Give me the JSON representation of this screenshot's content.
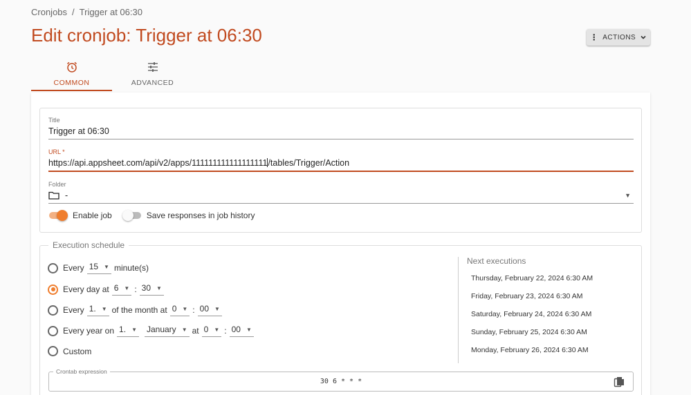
{
  "breadcrumb": {
    "root": "Cronjobs",
    "separator": "/",
    "current": "Trigger at 06:30"
  },
  "page_title": "Edit cronjob: Trigger at 06:30",
  "actions_label": "ACTIONS",
  "tabs": [
    {
      "label": "COMMON",
      "icon": "alarm-clock-icon",
      "active": true
    },
    {
      "label": "ADVANCED",
      "icon": "sliders-icon",
      "active": false
    }
  ],
  "form": {
    "title_label": "Title",
    "title_value": "Trigger at 06:30",
    "url_label": "URL *",
    "url_value": "https://api.appsheet.com/api/v2/apps/111111111111111111/tables/Trigger/Action",
    "folder_label": "Folder",
    "folder_value": "-",
    "enable_job_label": "Enable job",
    "enable_job_on": true,
    "save_responses_label": "Save responses in job history",
    "save_responses_on": false
  },
  "schedule": {
    "legend": "Execution schedule",
    "every_minutes": {
      "prefix": "Every",
      "value": "15",
      "suffix": "minute(s)"
    },
    "every_day": {
      "prefix": "Every day at",
      "hour": "6",
      "colon": ":",
      "minute": "30"
    },
    "every_month": {
      "prefix": "Every",
      "day": "1.",
      "middle": "of the month at",
      "hour": "0",
      "colon": ":",
      "minute": "00"
    },
    "every_year": {
      "prefix": "Every year on",
      "day": "1.",
      "month": "January",
      "at": "at",
      "hour": "0",
      "colon": ":",
      "minute": "00"
    },
    "custom_label": "Custom",
    "selected": "every_day",
    "crontab_label": "Crontab expression",
    "crontab_value": "30 6 * * *"
  },
  "next_executions": {
    "title": "Next executions",
    "items": [
      "Thursday, February 22, 2024 6:30 AM",
      "Friday, February 23, 2024 6:30 AM",
      "Saturday, February 24, 2024 6:30 AM",
      "Sunday, February 25, 2024 6:30 AM",
      "Monday, February 26, 2024 6:30 AM"
    ]
  },
  "colors": {
    "accent": "#c14a1f",
    "toggle_on": "#ef7d2d"
  }
}
